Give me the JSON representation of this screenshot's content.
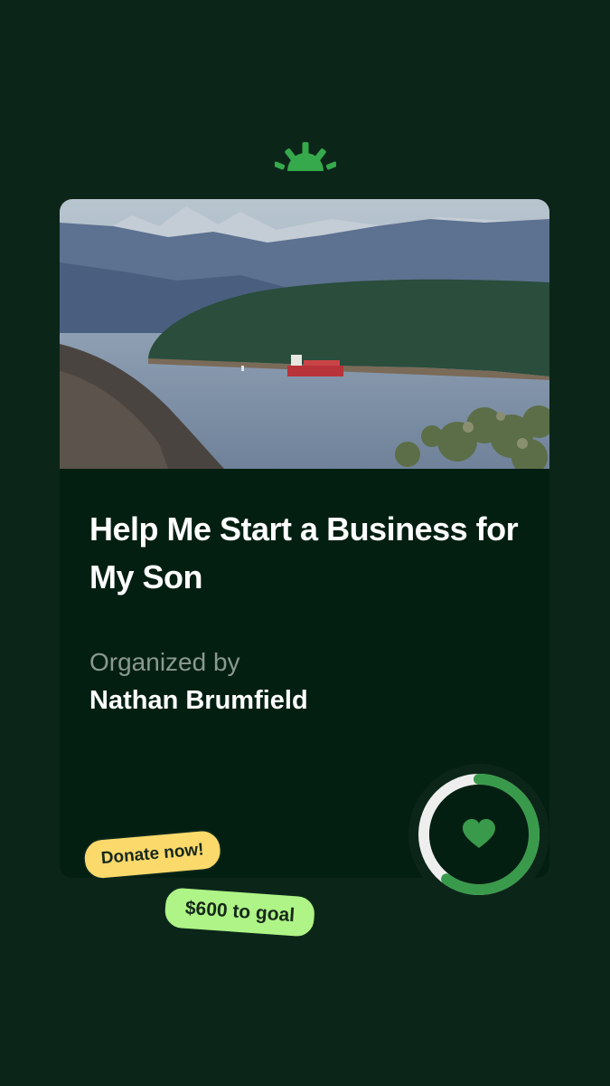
{
  "brand": {
    "logo_icon": "gofundme-sunrise-icon",
    "accent": "#32a852"
  },
  "fundraiser": {
    "image_icon": "coastal-bay-ship-photo",
    "title": "Help Me Start a Business for My Son",
    "organized_label": "Organized by",
    "organizer": "Nathan Brumfield"
  },
  "progress": {
    "fraction": 0.6,
    "icon": "heart-icon",
    "color": "#3a9a4b"
  },
  "badges": {
    "donate": "Donate now!",
    "goal": "$600 to goal"
  },
  "colors": {
    "background": "#0b2619",
    "card": "#031f12",
    "donate_badge": "#fbd96b",
    "goal_badge": "#aef486"
  }
}
